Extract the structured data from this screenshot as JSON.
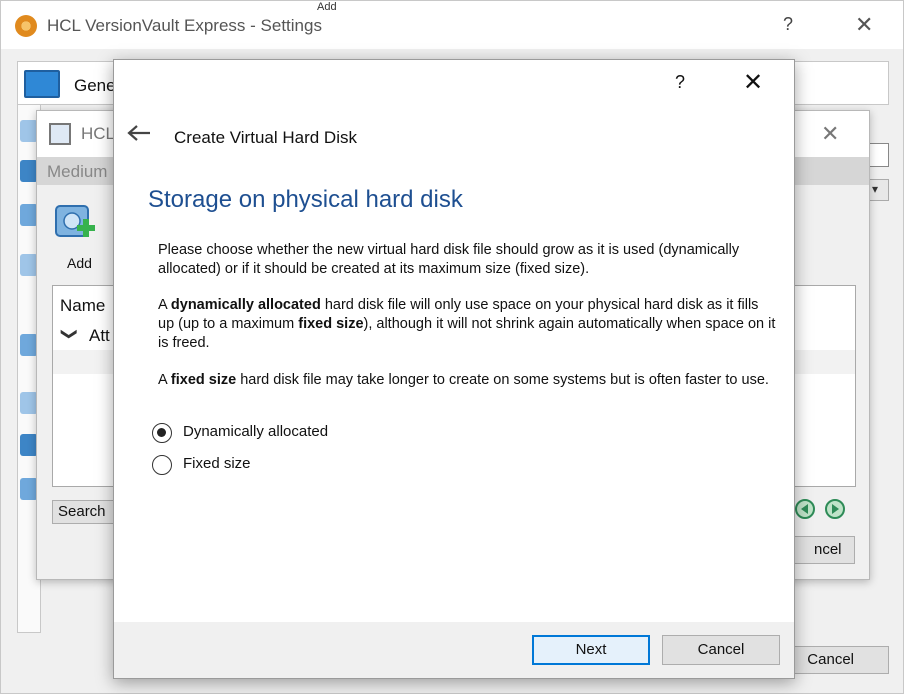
{
  "settings_window": {
    "title": "HCL VersionVault Express - Settings",
    "help_glyph": "?",
    "close_glyph": "✕",
    "add_peek": "Add",
    "general_label": "Gene",
    "cancel_label": "Cancel",
    "combo_arrow": "▾",
    "icons": [
      "app-icon",
      "general-icon"
    ]
  },
  "medium_window": {
    "title": "HCL",
    "close_glyph": "✕",
    "header_label": "Medium",
    "add_label": "Add",
    "column_header": "Name",
    "tree_chevron": "❯",
    "tree_row": "Att",
    "search_label": "Search",
    "cancel_label": "ncel"
  },
  "wizard": {
    "help_glyph": "?",
    "close_glyph": "✕",
    "title": "Create Virtual Hard Disk",
    "page_heading": "Storage on physical hard disk",
    "para1": "Please choose whether the new virtual hard disk file should grow as it is used (dynamically allocated) or if it should be created at its maximum size (fixed size).",
    "para2": {
      "t1": "A ",
      "b1": "dynamically allocated",
      "t2": " hard disk file will only use space on your physical hard disk as it fills up (up to a maximum ",
      "b2": "fixed size",
      "t3": "), although it will not shrink again automatically when space on it is freed."
    },
    "para3": {
      "t1": "A ",
      "b1": "fixed size",
      "t2": " hard disk file may take longer to create on some systems but is often faster to use."
    },
    "options": [
      {
        "label": "Dynamically allocated",
        "selected": true
      },
      {
        "label": "Fixed size",
        "selected": false
      }
    ],
    "next_label": "Next",
    "cancel_label": "Cancel"
  },
  "colors": {
    "heading": "#1e4f91",
    "focus_border": "#0078d7",
    "dialog_footer": "#f0f0f0"
  }
}
